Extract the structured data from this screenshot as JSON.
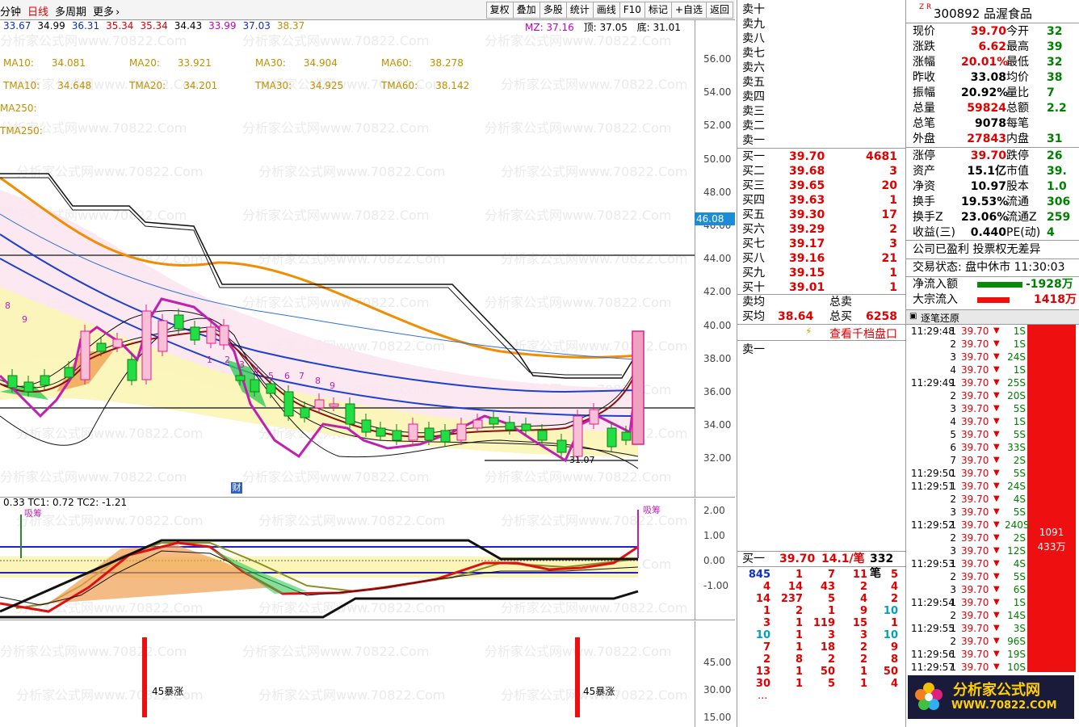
{
  "toolbar": {
    "left_items": [
      "分钟",
      "日线",
      "多周期",
      "更多"
    ],
    "buttons": [
      "复权",
      "叠加",
      "多股",
      "统计",
      "画线",
      "F10",
      "标记",
      "+自选",
      "返回"
    ]
  },
  "main_chart": {
    "price_row": [
      "33.67",
      "34.99",
      "36.31",
      "35.34",
      "35.34",
      "34.43",
      "33.99",
      "37.03",
      "38.37"
    ],
    "mz": "MZ: 37.16",
    "top": "顶: 37.05",
    "bottom": "底: 31.01",
    "ma_row1": [
      {
        "label": "MA10:",
        "value": "34.081"
      },
      {
        "label": "MA20:",
        "value": "33.921"
      },
      {
        "label": "MA30:",
        "value": "34.904"
      },
      {
        "label": "MA60:",
        "value": "38.278"
      }
    ],
    "ma_row2": [
      {
        "label": "TMA10:",
        "value": "34.648"
      },
      {
        "label": "TMA20:",
        "value": "34.201"
      },
      {
        "label": "TMA30:",
        "value": "34.925"
      },
      {
        "label": "TMA60:",
        "value": "38.142"
      }
    ],
    "ma250": "MA250:",
    "tma250": "TMA250:",
    "current_price_tag": "46.08",
    "low_label": "31.07",
    "finance_marker": "财",
    "y_ticks": [
      "56.00",
      "54.00",
      "52.00",
      "50.00",
      "48.00",
      "46.00",
      "44.00",
      "42.00",
      "40.00",
      "38.00",
      "36.00",
      "34.00",
      "32.00"
    ]
  },
  "sub_chart1": {
    "legend": "0.33  TC1: 0.72  TC2: -1.21",
    "left_signal": "吸筹",
    "right_signal": "吸筹",
    "y_ticks": [
      "2.00",
      "1.00",
      "0.00",
      "-1.00"
    ]
  },
  "sub_chart2": {
    "bar_label": "45暴涨",
    "y_ticks": [
      "45.00",
      "30.00",
      "15.00"
    ]
  },
  "orderbook": {
    "sell_labels": [
      "卖十",
      "卖九",
      "卖八",
      "卖七",
      "卖六",
      "卖五",
      "卖四",
      "卖三",
      "卖二",
      "卖一"
    ],
    "buy_levels": [
      {
        "label": "买一",
        "price": "39.70",
        "vol": "4681"
      },
      {
        "label": "买二",
        "price": "39.68",
        "vol": "3"
      },
      {
        "label": "买三",
        "price": "39.65",
        "vol": "20"
      },
      {
        "label": "买四",
        "price": "39.63",
        "vol": "1"
      },
      {
        "label": "买五",
        "price": "39.30",
        "vol": "17"
      },
      {
        "label": "买六",
        "price": "39.29",
        "vol": "2"
      },
      {
        "label": "买七",
        "price": "39.17",
        "vol": "3"
      },
      {
        "label": "买八",
        "price": "39.16",
        "vol": "21"
      },
      {
        "label": "买九",
        "price": "39.15",
        "vol": "1"
      },
      {
        "label": "买十",
        "price": "39.01",
        "vol": "1"
      }
    ],
    "sell_avg_label": "卖均",
    "buy_avg_label": "买均",
    "buy_avg": "38.64",
    "total_sell_label": "总卖",
    "total_buy_label": "总买",
    "total_buy": "6258",
    "thousand_link": "查看千档盘口",
    "sell1_label": "卖一",
    "queue_header": {
      "label": "买一",
      "price": "39.70",
      "per": "14.1/笔",
      "count": "332笔"
    },
    "queue": [
      [
        "845",
        "1",
        "7",
        "11",
        "5"
      ],
      [
        "4",
        "14",
        "43",
        "2",
        "4"
      ],
      [
        "14",
        "237",
        "5",
        "4",
        "2"
      ],
      [
        "1",
        "2",
        "1",
        "9",
        "10"
      ],
      [
        "3",
        "1",
        "119",
        "15",
        "1"
      ],
      [
        "10",
        "1",
        "3",
        "3",
        "10"
      ],
      [
        "7",
        "1",
        "18",
        "2",
        "9"
      ],
      [
        "2",
        "8",
        "2",
        "2",
        "8"
      ],
      [
        "13",
        "1",
        "50",
        "1",
        "50"
      ],
      [
        "30",
        "1",
        "5",
        "1",
        "4"
      ]
    ],
    "queue_more": "..."
  },
  "info": {
    "flag": "Z R",
    "code": "300892",
    "name": "品渥食品",
    "rows": [
      {
        "k1": "现价",
        "v1": "39.70",
        "c1": "red",
        "k2": "今开",
        "v2": "32"
      },
      {
        "k1": "涨跌",
        "v1": "6.62",
        "c1": "red",
        "k2": "最高",
        "v2": "39"
      },
      {
        "k1": "涨幅",
        "v1": "20.01%",
        "c1": "red",
        "k2": "最低",
        "v2": "32"
      },
      {
        "k1": "昨收",
        "v1": "33.08",
        "c1": "black",
        "k2": "均价",
        "v2": "38"
      },
      {
        "k1": "振幅",
        "v1": "20.92%",
        "c1": "black",
        "k2": "量比",
        "v2": "7"
      },
      {
        "k1": "总量",
        "v1": "59824",
        "c1": "red",
        "k2": "总额",
        "v2": "2.2"
      },
      {
        "k1": "总笔",
        "v1": "9078",
        "c1": "black",
        "k2": "每笔",
        "v2": ""
      },
      {
        "k1": "外盘",
        "v1": "27843",
        "c1": "red",
        "k2": "内盘",
        "v2": "31"
      }
    ],
    "rows2": [
      {
        "k1": "涨停",
        "v1": "39.70",
        "c1": "red",
        "k2": "跌停",
        "v2": "26"
      },
      {
        "k1": "资产",
        "v1": "15.1亿",
        "c1": "black",
        "k2": "市值",
        "v2": "39."
      },
      {
        "k1": "净资",
        "v1": "10.97",
        "c1": "black",
        "k2": "股本",
        "v2": "1.0"
      },
      {
        "k1": "换手",
        "v1": "19.53%",
        "c1": "black",
        "k2": "流通",
        "v2": "306"
      },
      {
        "k1": "换手Z",
        "v1": "23.06%",
        "c1": "black",
        "k2": "流通Z",
        "v2": "259"
      },
      {
        "k1": "收益(三)",
        "v1": "0.440",
        "c1": "black",
        "k2": "PE(动)",
        "v2": "4"
      }
    ],
    "notice": "公司已盈利 投票权无差异",
    "trade_status": "交易状态: 盘中休市 11:30:03",
    "net_inflow_label": "净流入额",
    "net_inflow": "-1928万",
    "block_inflow_label": "大宗流入",
    "block_inflow": "1418万",
    "tick_header": "逐笔还原",
    "bar_text1": "1091",
    "bar_text2": "433万",
    "banner_name": "分析家公式网",
    "banner_url": "WWW.70822.COM"
  },
  "trades": [
    {
      "t": "11:29:48",
      "n": "1",
      "p": "39.70",
      "v": "1S"
    },
    {
      "t": "",
      "n": "2",
      "p": "39.70",
      "v": "1S"
    },
    {
      "t": "",
      "n": "3",
      "p": "39.70",
      "v": "24S"
    },
    {
      "t": "",
      "n": "4",
      "p": "39.70",
      "v": "1S"
    },
    {
      "t": "11:29:49",
      "n": "1",
      "p": "39.70",
      "v": "25S"
    },
    {
      "t": "",
      "n": "2",
      "p": "39.70",
      "v": "20S"
    },
    {
      "t": "",
      "n": "3",
      "p": "39.70",
      "v": "5S"
    },
    {
      "t": "",
      "n": "4",
      "p": "39.70",
      "v": "1S"
    },
    {
      "t": "",
      "n": "5",
      "p": "39.70",
      "v": "5S"
    },
    {
      "t": "",
      "n": "6",
      "p": "39.70",
      "v": "33S"
    },
    {
      "t": "",
      "n": "7",
      "p": "39.70",
      "v": "2S"
    },
    {
      "t": "11:29:50",
      "n": "1",
      "p": "39.70",
      "v": "5S"
    },
    {
      "t": "11:29:51",
      "n": "1",
      "p": "39.70",
      "v": "24S"
    },
    {
      "t": "",
      "n": "2",
      "p": "39.70",
      "v": "4S"
    },
    {
      "t": "",
      "n": "3",
      "p": "39.70",
      "v": "5S"
    },
    {
      "t": "11:29:52",
      "n": "1",
      "p": "39.70",
      "v": "240S"
    },
    {
      "t": "",
      "n": "2",
      "p": "39.70",
      "v": "2S"
    },
    {
      "t": "",
      "n": "3",
      "p": "39.70",
      "v": "12S"
    },
    {
      "t": "11:29:53",
      "n": "1",
      "p": "39.70",
      "v": "4S"
    },
    {
      "t": "",
      "n": "2",
      "p": "39.70",
      "v": "5S"
    },
    {
      "t": "",
      "n": "3",
      "p": "39.70",
      "v": "6S"
    },
    {
      "t": "11:29:54",
      "n": "1",
      "p": "39.70",
      "v": "1S"
    },
    {
      "t": "",
      "n": "2",
      "p": "39.70",
      "v": "14S"
    },
    {
      "t": "11:29:55",
      "n": "1",
      "p": "39.70",
      "v": "3S"
    },
    {
      "t": "",
      "n": "2",
      "p": "39.70",
      "v": "96S"
    },
    {
      "t": "11:29:56",
      "n": "1",
      "p": "39.70",
      "v": "19S"
    },
    {
      "t": "11:29:57",
      "n": "1",
      "p": "39.70",
      "v": "10S"
    }
  ],
  "watermark": "分析家公式网www.70822.Com"
}
